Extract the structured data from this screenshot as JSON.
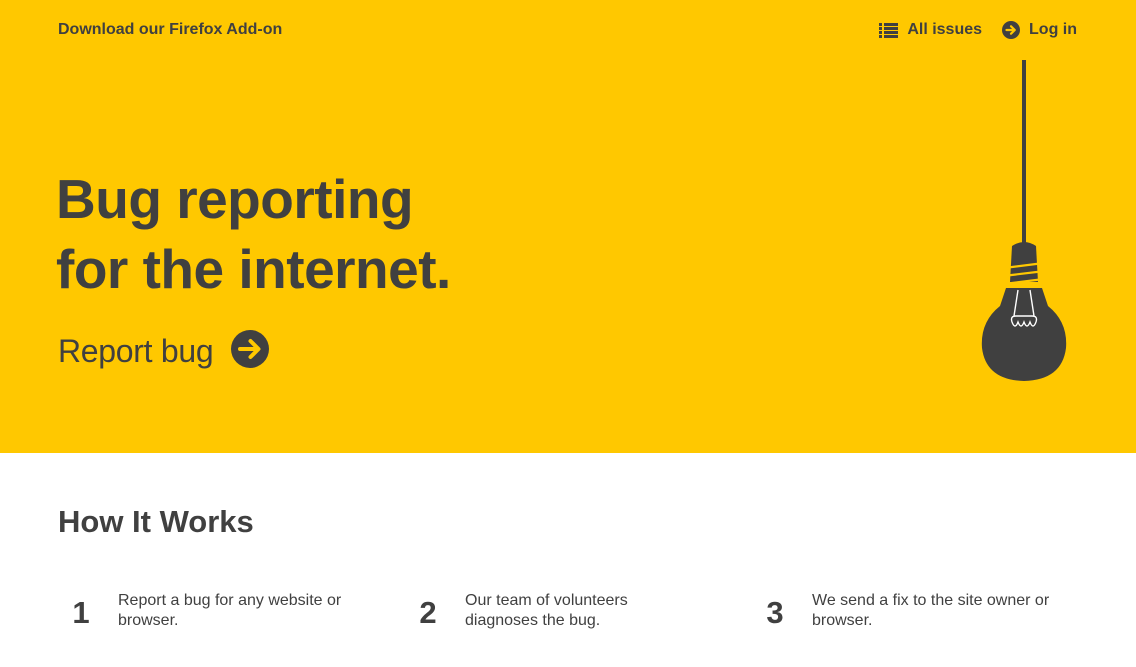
{
  "header": {
    "addon_link": "Download our Firefox Add-on",
    "nav": {
      "all_issues": "All issues",
      "log_in": "Log in"
    }
  },
  "hero": {
    "headline_line1": "Bug reporting",
    "headline_line2": "for the internet.",
    "report_bug": "Report bug"
  },
  "how_it_works": {
    "title": "How It Works",
    "steps": [
      {
        "number": "1",
        "text": "Report a bug for any website or browser."
      },
      {
        "number": "2",
        "text": "Our team of volunteers diagnoses the bug."
      },
      {
        "number": "3",
        "text": "We send a fix to the site owner or browser."
      }
    ]
  },
  "colors": {
    "brand_yellow": "#FFC800",
    "text_dark": "#404040"
  },
  "icons": [
    "list-icon",
    "arrow-circle-icon",
    "lightbulb-icon",
    "bug-icon"
  ]
}
